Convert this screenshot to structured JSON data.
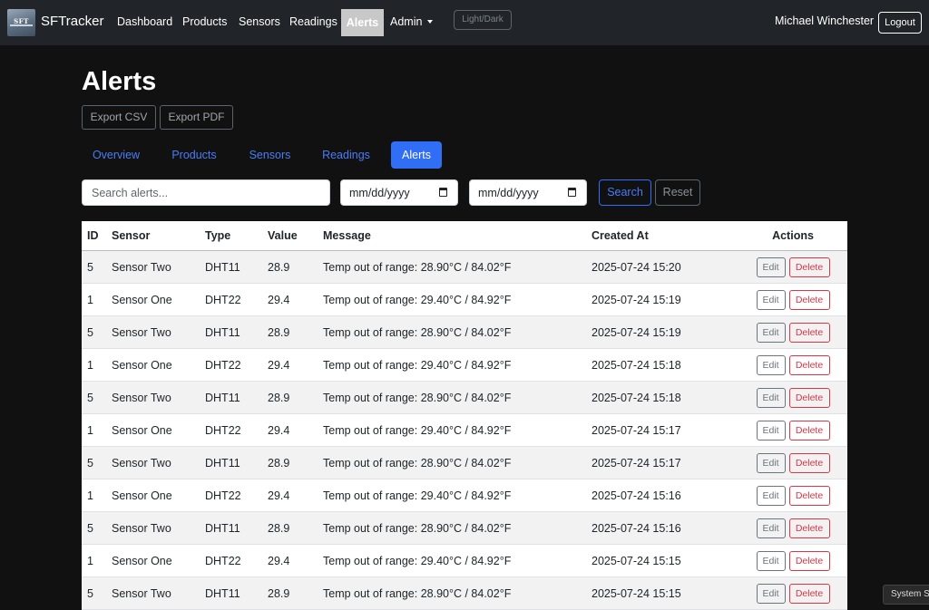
{
  "navbar": {
    "logo_text": "SFT",
    "brand": "SFTracker",
    "links": [
      "Dashboard",
      "Products",
      "Sensors",
      "Readings"
    ],
    "active_link": "Alerts",
    "admin_label": "Admin",
    "theme_toggle": "Light/Dark",
    "user_name": "Michael Winchester",
    "logout_label": "Logout"
  },
  "page": {
    "title": "Alerts",
    "export_csv": "Export CSV",
    "export_pdf": "Export PDF"
  },
  "tabs": [
    {
      "label": "Overview",
      "active": false
    },
    {
      "label": "Products",
      "active": false
    },
    {
      "label": "Sensors",
      "active": false
    },
    {
      "label": "Readings",
      "active": false
    },
    {
      "label": "Alerts",
      "active": true
    }
  ],
  "filters": {
    "search_placeholder": "Search alerts...",
    "date_from": "mm/dd/yyyy",
    "date_to": "mm/dd/yyyy",
    "search_label": "Search",
    "reset_label": "Reset"
  },
  "table": {
    "headers": [
      "ID",
      "Sensor",
      "Type",
      "Value",
      "Message",
      "Created At",
      "Actions"
    ],
    "edit_label": "Edit",
    "delete_label": "Delete",
    "rows": [
      {
        "id": "5",
        "sensor": "Sensor Two",
        "type": "DHT11",
        "value": "28.9",
        "message": "Temp out of range: 28.90°C / 84.02°F",
        "created_at": "2025-07-24 15:20"
      },
      {
        "id": "1",
        "sensor": "Sensor One",
        "type": "DHT22",
        "value": "29.4",
        "message": "Temp out of range: 29.40°C / 84.92°F",
        "created_at": "2025-07-24 15:19"
      },
      {
        "id": "5",
        "sensor": "Sensor Two",
        "type": "DHT11",
        "value": "28.9",
        "message": "Temp out of range: 28.90°C / 84.02°F",
        "created_at": "2025-07-24 15:19"
      },
      {
        "id": "1",
        "sensor": "Sensor One",
        "type": "DHT22",
        "value": "29.4",
        "message": "Temp out of range: 29.40°C / 84.92°F",
        "created_at": "2025-07-24 15:18"
      },
      {
        "id": "5",
        "sensor": "Sensor Two",
        "type": "DHT11",
        "value": "28.9",
        "message": "Temp out of range: 28.90°C / 84.02°F",
        "created_at": "2025-07-24 15:18"
      },
      {
        "id": "1",
        "sensor": "Sensor One",
        "type": "DHT22",
        "value": "29.4",
        "message": "Temp out of range: 29.40°C / 84.92°F",
        "created_at": "2025-07-24 15:17"
      },
      {
        "id": "5",
        "sensor": "Sensor Two",
        "type": "DHT11",
        "value": "28.9",
        "message": "Temp out of range: 28.90°C / 84.02°F",
        "created_at": "2025-07-24 15:17"
      },
      {
        "id": "1",
        "sensor": "Sensor One",
        "type": "DHT22",
        "value": "29.4",
        "message": "Temp out of range: 29.40°C / 84.92°F",
        "created_at": "2025-07-24 15:16"
      },
      {
        "id": "5",
        "sensor": "Sensor Two",
        "type": "DHT11",
        "value": "28.9",
        "message": "Temp out of range: 28.90°C / 84.02°F",
        "created_at": "2025-07-24 15:16"
      },
      {
        "id": "1",
        "sensor": "Sensor One",
        "type": "DHT22",
        "value": "29.4",
        "message": "Temp out of range: 29.40°C / 84.92°F",
        "created_at": "2025-07-24 15:15"
      },
      {
        "id": "5",
        "sensor": "Sensor Two",
        "type": "DHT11",
        "value": "28.9",
        "message": "Temp out of range: 28.90°C / 84.02°F",
        "created_at": "2025-07-24 15:15"
      }
    ]
  },
  "corner_tab": "System S"
}
